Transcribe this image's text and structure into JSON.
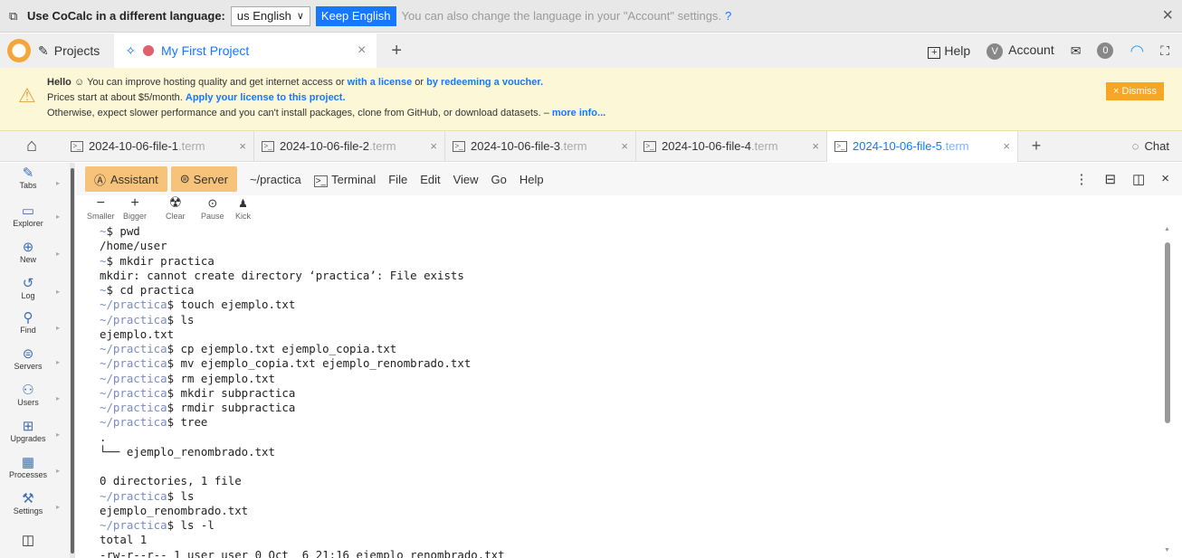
{
  "lang_bar": {
    "prompt": "Use CoCalc in a different language:",
    "selected": "us English",
    "keep_button": "Keep English",
    "hint": "You can also change the language in your \"Account\" settings."
  },
  "top_bar": {
    "projects_label": "Projects",
    "project_tab": "My First Project",
    "help": "Help",
    "account_initial": "V",
    "account": "Account",
    "notif_count": "0"
  },
  "banner": {
    "hello": "Hello",
    "line1_a": "You can improve hosting quality and get internet access or",
    "line1_link1": "with a license",
    "line1_b": "or",
    "line1_link2": "by redeeming a voucher.",
    "line2_a": "Prices start at about $5/month.",
    "line2_link": "Apply your license to this project.",
    "line3_a": "Otherwise, expect slower performance and you can't install packages, clone from GitHub, or download datasets. –",
    "line3_link": "more info...",
    "dismiss": "Dismiss"
  },
  "file_tabs": [
    {
      "name": "2024-10-06-file-1",
      "ext": ".term"
    },
    {
      "name": "2024-10-06-file-2",
      "ext": ".term"
    },
    {
      "name": "2024-10-06-file-3",
      "ext": ".term"
    },
    {
      "name": "2024-10-06-file-4",
      "ext": ".term"
    },
    {
      "name": "2024-10-06-file-5",
      "ext": ".term"
    }
  ],
  "chat_label": "Chat",
  "sidebar": [
    {
      "label": "Tabs"
    },
    {
      "label": "Explorer"
    },
    {
      "label": "New"
    },
    {
      "label": "Log"
    },
    {
      "label": "Find"
    },
    {
      "label": "Servers"
    },
    {
      "label": "Users"
    },
    {
      "label": "Upgrades"
    },
    {
      "label": "Processes"
    },
    {
      "label": "Settings"
    }
  ],
  "term_toolbar": {
    "assistant": "Assistant",
    "server": "Server",
    "path": "~/practica",
    "terminal": "Terminal",
    "menus": [
      "File",
      "Edit",
      "View",
      "Go",
      "Help"
    ]
  },
  "term_tools": [
    {
      "label": "Smaller"
    },
    {
      "label": "Bigger"
    },
    {
      "label": "Clear"
    },
    {
      "label": "Pause"
    },
    {
      "label": "Kick"
    }
  ],
  "terminal": {
    "prompt_path": "~/practica",
    "lines": [
      {
        "prefix": "~",
        "cmd": "$ pwd"
      },
      {
        "text": "/home/user"
      },
      {
        "prefix": "~",
        "cmd": "$ mkdir practica"
      },
      {
        "text": "mkdir: cannot create directory ‘practica’: File exists"
      },
      {
        "prefix": "~",
        "cmd": "$ cd practica"
      },
      {
        "prefix": "~/practica",
        "cmd": "$ touch ejemplo.txt"
      },
      {
        "prefix": "~/practica",
        "cmd": "$ ls"
      },
      {
        "text": "ejemplo.txt"
      },
      {
        "prefix": "~/practica",
        "cmd": "$ cp ejemplo.txt ejemplo_copia.txt"
      },
      {
        "prefix": "~/practica",
        "cmd": "$ mv ejemplo_copia.txt ejemplo_renombrado.txt"
      },
      {
        "prefix": "~/practica",
        "cmd": "$ rm ejemplo.txt"
      },
      {
        "prefix": "~/practica",
        "cmd": "$ mkdir subpractica"
      },
      {
        "prefix": "~/practica",
        "cmd": "$ rmdir subpractica"
      },
      {
        "prefix": "~/practica",
        "cmd": "$ tree"
      },
      {
        "text": "."
      },
      {
        "text": "└── ejemplo_renombrado.txt"
      },
      {
        "text": ""
      },
      {
        "text": "0 directories, 1 file"
      },
      {
        "prefix": "~/practica",
        "cmd": "$ ls"
      },
      {
        "text": "ejemplo_renombrado.txt"
      },
      {
        "prefix": "~/practica",
        "cmd": "$ ls -l"
      },
      {
        "text": "total 1"
      },
      {
        "text": "-rw-r--r-- 1 user user 0 Oct  6 21:16 ejemplo_renombrado.txt"
      }
    ]
  }
}
